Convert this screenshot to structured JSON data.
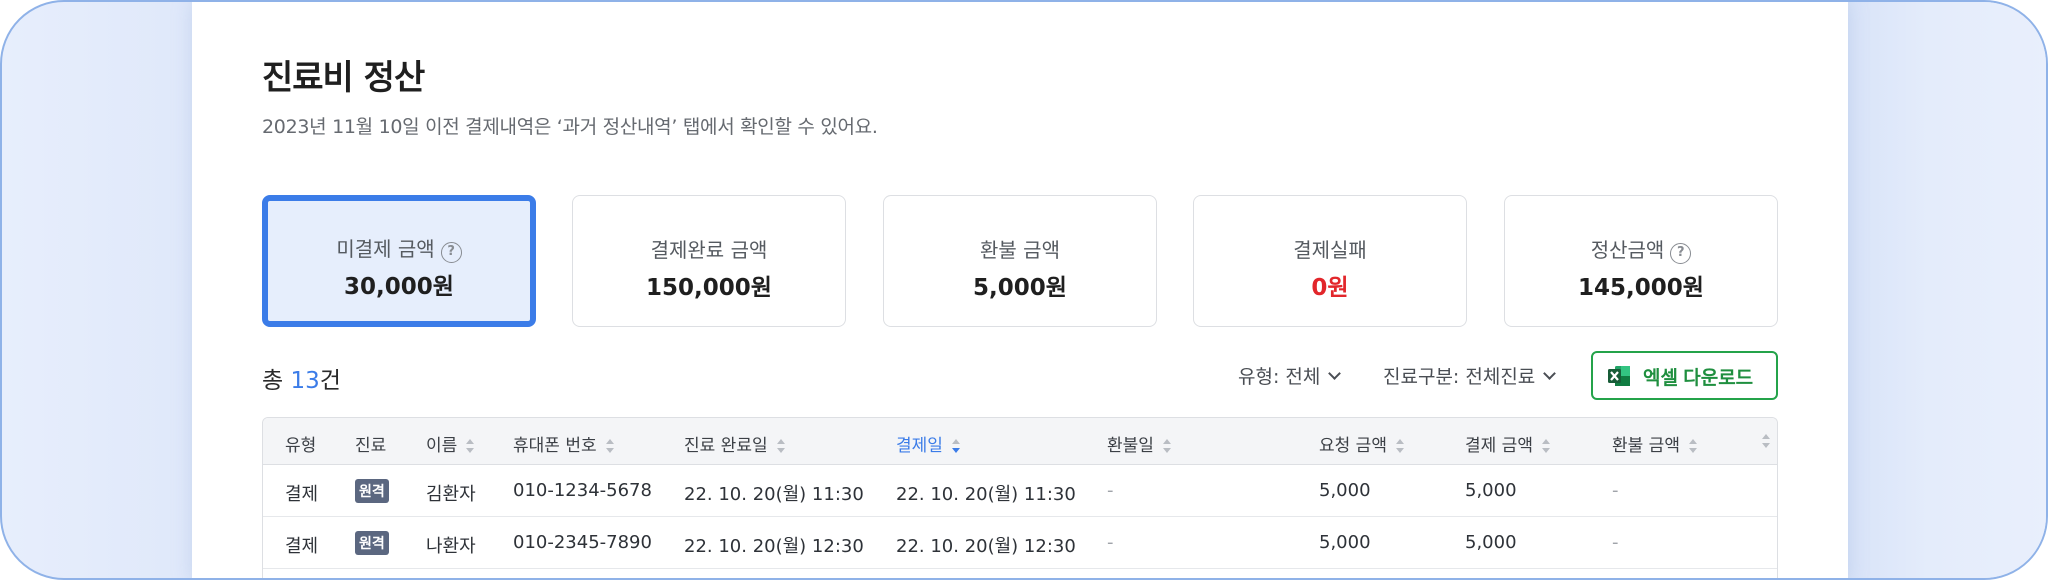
{
  "page": {
    "title": "진료비 정산",
    "description": "2023년 11월 10일 이전 결제내역은 ‘과거 정산내역’ 탭에서 확인할 수 있어요."
  },
  "cards": [
    {
      "label": "미결제 금액",
      "value": "30,000원",
      "help": true,
      "active": true
    },
    {
      "label": "결제완료 금액",
      "value": "150,000원"
    },
    {
      "label": "환불 금액",
      "value": "5,000원"
    },
    {
      "label": "결제실패",
      "value": "0원",
      "color": "#e2262b"
    },
    {
      "label": "정산금액",
      "value": "145,000원",
      "help": true
    }
  ],
  "summary": {
    "prefix": "총 ",
    "count": "13",
    "suffix": "건"
  },
  "filters": {
    "type": "유형: 전체",
    "category": "진료구분: 전체진료",
    "excel_button": "엑셀 다운로드"
  },
  "table": {
    "headers": [
      "유형",
      "진료",
      "이름",
      "휴대폰 번호",
      "진료 완료일",
      "결제일",
      "환불일",
      "요청 금액",
      "결제 금액",
      "환불 금액"
    ],
    "rows": [
      [
        "결제",
        "원격",
        "김환자",
        "010-1234-5678",
        "22. 10. 20(월) 11:30",
        "22. 10. 20(월) 11:30",
        "-",
        "5,000",
        "5,000",
        "-"
      ],
      [
        "결제",
        "원격",
        "나환자",
        "010-2345-7890",
        "22. 10. 20(월) 12:30",
        "22. 10. 20(월) 12:30",
        "-",
        "5,000",
        "5,000",
        "-"
      ]
    ]
  },
  "colors": {
    "accent": "#3b7ce8",
    "excel_green": "#24a34a",
    "error": "#e2262b"
  },
  "icons": {
    "help": "question-circle-icon",
    "excel": "excel-icon",
    "chevron": "chevron-down-icon",
    "sort": "sort-icon"
  }
}
